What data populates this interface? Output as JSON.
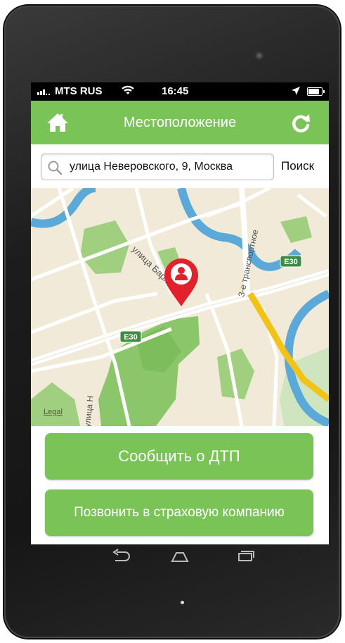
{
  "status_bar": {
    "carrier": "MTS RUS",
    "time": "16:45"
  },
  "nav": {
    "title": "Местоположение",
    "left_icon": "home-icon",
    "right_icon": "refresh-icon"
  },
  "search": {
    "value": "улица Неверовского, 9, Москва",
    "button_label": "Поиск",
    "icon": "search-icon"
  },
  "map": {
    "street_labels": [
      "улица Барклая",
      "3-е транспортное",
      "улица Н"
    ],
    "route_badges": [
      "E30",
      "E30"
    ],
    "legal_label": "Legal",
    "pin_icon": "person-location-pin-icon"
  },
  "actions": {
    "report_label": "Сообщить о ДТП",
    "call_label": "Позвонить в  страховую компанию"
  },
  "colors": {
    "accent_green": "#7ac457",
    "pin_red": "#e2212c",
    "road_yellow": "#f2c316",
    "water": "#5aa9d8"
  },
  "system_nav": [
    "back-icon",
    "home-outline-icon",
    "recent-apps-icon"
  ]
}
